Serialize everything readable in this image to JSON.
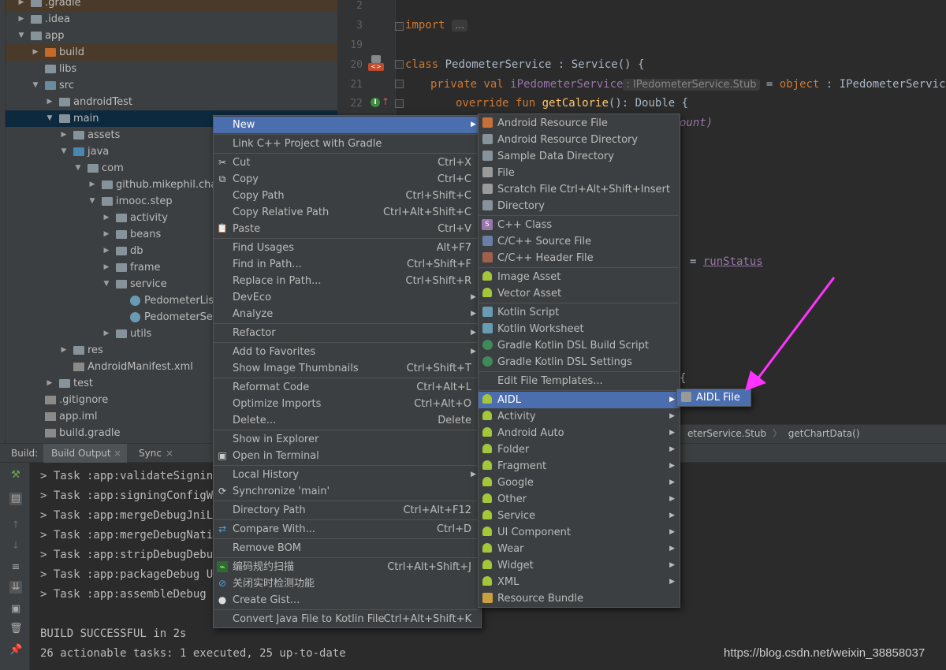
{
  "tree": {
    "items": [
      {
        "label": ".gradle",
        "depth": 1,
        "kind": "folder",
        "open": false
      },
      {
        "label": ".idea",
        "depth": 1,
        "kind": "folder",
        "open": false
      },
      {
        "label": "app",
        "depth": 1,
        "kind": "folder",
        "open": true
      },
      {
        "label": "build",
        "depth": 2,
        "kind": "build",
        "open": false
      },
      {
        "label": "libs",
        "depth": 2,
        "kind": "folder",
        "open": null
      },
      {
        "label": "src",
        "depth": 2,
        "kind": "src",
        "open": true
      },
      {
        "label": "androidTest",
        "depth": 3,
        "kind": "folder",
        "open": false
      },
      {
        "label": "main",
        "depth": 3,
        "kind": "folder",
        "open": true
      },
      {
        "label": "assets",
        "depth": 4,
        "kind": "folder",
        "open": false
      },
      {
        "label": "java",
        "depth": 4,
        "kind": "java",
        "open": true
      },
      {
        "label": "com",
        "depth": 5,
        "kind": "folder",
        "open": true
      },
      {
        "label": "github.mikephil.char",
        "depth": 6,
        "kind": "folder",
        "open": false
      },
      {
        "label": "imooc.step",
        "depth": 6,
        "kind": "folder",
        "open": true
      },
      {
        "label": "activity",
        "depth": 7,
        "kind": "folder",
        "open": false
      },
      {
        "label": "beans",
        "depth": 7,
        "kind": "folder",
        "open": false
      },
      {
        "label": "db",
        "depth": 7,
        "kind": "folder",
        "open": false
      },
      {
        "label": "frame",
        "depth": 7,
        "kind": "folder",
        "open": false
      },
      {
        "label": "service",
        "depth": 7,
        "kind": "folder",
        "open": true
      },
      {
        "label": "PedometerList",
        "depth": 8,
        "kind": "kt",
        "open": null
      },
      {
        "label": "PedometerSer",
        "depth": 8,
        "kind": "kt",
        "open": null
      },
      {
        "label": "utils",
        "depth": 7,
        "kind": "folder",
        "open": false
      },
      {
        "label": "res",
        "depth": 4,
        "kind": "folder",
        "open": false
      },
      {
        "label": "AndroidManifest.xml",
        "depth": 4,
        "kind": "file",
        "open": null
      },
      {
        "label": "test",
        "depth": 3,
        "kind": "folder",
        "open": false
      },
      {
        "label": ".gitignore",
        "depth": 2,
        "kind": "file",
        "open": null
      },
      {
        "label": "app.iml",
        "depth": 2,
        "kind": "file",
        "open": null
      },
      {
        "label": "build.gradle",
        "depth": 2,
        "kind": "file",
        "open": null
      }
    ]
  },
  "editor": {
    "line_numbers": [
      "2",
      "3",
      "19",
      "20",
      "21",
      "22"
    ],
    "line3_kw": "import",
    "line3_fold": "...",
    "line20_kw": "class",
    "line20_rest": " PedometerService : Service() {",
    "line21_kw": "private val",
    "line21_var": "iPedometerService",
    "line21_hint": ": IPedometerService.Stub",
    "line21_rest": " = ",
    "line21_kw2": "object",
    "line21_rest2": " : IPedometerServic",
    "line22_kw": "override fun",
    "line22_fn": "getCalorie",
    "line22_rest": "(): Double {",
    "frag_ount": "ount)",
    "frag_eq": "= ",
    "frag_run": "runStatus",
    "frag_brace": "{"
  },
  "breadcrumb": {
    "part1": "eterService.Stub",
    "sep": "〉",
    "part2": "getChartData()"
  },
  "build": {
    "label": "Build:",
    "tabs": [
      "Build Output",
      "Sync"
    ],
    "lines": [
      "> Task :app:validateSigningD",
      "> Task :app:signingConfigWr",
      "> Task :app:mergeDebugJniLi",
      "> Task :app:mergeDebugNativ",
      "> Task :app:stripDebugDebug",
      "> Task :app:packageDebug UP",
      "> Task :app:assembleDebug U"
    ],
    "success": "BUILD SUCCESSFUL in 2s",
    "summary": "26 actionable tasks: 1 executed, 25 up-to-date"
  },
  "context_menu": {
    "items": [
      {
        "label": "New",
        "shortcut": "",
        "submenu": true,
        "active": true,
        "icon": ""
      },
      {
        "sep": true
      },
      {
        "label": "Link C++ Project with Gradle",
        "shortcut": "",
        "submenu": false,
        "icon": ""
      },
      {
        "sep": true
      },
      {
        "label": "Cut",
        "shortcut": "Ctrl+X",
        "submenu": false,
        "icon": "scissors-icon"
      },
      {
        "label": "Copy",
        "shortcut": "Ctrl+C",
        "submenu": false,
        "icon": "copy-icon"
      },
      {
        "label": "Copy Path",
        "shortcut": "Ctrl+Shift+C",
        "submenu": false,
        "icon": ""
      },
      {
        "label": "Copy Relative Path",
        "shortcut": "Ctrl+Alt+Shift+C",
        "submenu": false,
        "icon": ""
      },
      {
        "label": "Paste",
        "shortcut": "Ctrl+V",
        "submenu": false,
        "icon": "paste-icon"
      },
      {
        "sep": true
      },
      {
        "label": "Find Usages",
        "shortcut": "Alt+F7",
        "submenu": false,
        "icon": ""
      },
      {
        "label": "Find in Path...",
        "shortcut": "Ctrl+Shift+F",
        "submenu": false,
        "icon": ""
      },
      {
        "label": "Replace in Path...",
        "shortcut": "Ctrl+Shift+R",
        "submenu": false,
        "icon": ""
      },
      {
        "label": "DevEco",
        "shortcut": "",
        "submenu": true,
        "icon": ""
      },
      {
        "label": "Analyze",
        "shortcut": "",
        "submenu": true,
        "icon": ""
      },
      {
        "sep": true
      },
      {
        "label": "Refactor",
        "shortcut": "",
        "submenu": true,
        "icon": ""
      },
      {
        "sep": true
      },
      {
        "label": "Add to Favorites",
        "shortcut": "",
        "submenu": true,
        "icon": ""
      },
      {
        "label": "Show Image Thumbnails",
        "shortcut": "Ctrl+Shift+T",
        "submenu": false,
        "icon": ""
      },
      {
        "sep": true
      },
      {
        "label": "Reformat Code",
        "shortcut": "Ctrl+Alt+L",
        "submenu": false,
        "icon": ""
      },
      {
        "label": "Optimize Imports",
        "shortcut": "Ctrl+Alt+O",
        "submenu": false,
        "icon": ""
      },
      {
        "label": "Delete...",
        "shortcut": "Delete",
        "submenu": false,
        "icon": ""
      },
      {
        "sep": true
      },
      {
        "label": "Show in Explorer",
        "shortcut": "",
        "submenu": false,
        "icon": ""
      },
      {
        "label": "Open in Terminal",
        "shortcut": "",
        "submenu": false,
        "icon": "terminal-icon"
      },
      {
        "sep": true
      },
      {
        "label": "Local History",
        "shortcut": "",
        "submenu": true,
        "icon": ""
      },
      {
        "label": "Synchronize 'main'",
        "shortcut": "",
        "submenu": false,
        "icon": "sync-icon"
      },
      {
        "sep": true
      },
      {
        "label": "Directory Path",
        "shortcut": "Ctrl+Alt+F12",
        "submenu": false,
        "icon": ""
      },
      {
        "sep": true
      },
      {
        "label": "Compare With...",
        "shortcut": "Ctrl+D",
        "submenu": false,
        "icon": "compare-icon"
      },
      {
        "sep": true
      },
      {
        "label": "Remove BOM",
        "shortcut": "",
        "submenu": false,
        "icon": ""
      },
      {
        "sep": true
      },
      {
        "label": "编码规约扫描",
        "shortcut": "Ctrl+Alt+Shift+J",
        "submenu": false,
        "icon": "scan-icon"
      },
      {
        "label": "关闭实时检测功能",
        "shortcut": "",
        "submenu": false,
        "icon": "disable-icon"
      },
      {
        "label": "Create Gist...",
        "shortcut": "",
        "submenu": false,
        "icon": "github-icon"
      },
      {
        "sep": true
      },
      {
        "label": "Convert Java File to Kotlin File",
        "shortcut": "Ctrl+Alt+Shift+K",
        "submenu": false,
        "icon": ""
      }
    ]
  },
  "new_menu": {
    "items": [
      {
        "label": "Android Resource File",
        "shortcut": "",
        "submenu": false,
        "icon": "android-resource-file-icon",
        "color": "#c8703a"
      },
      {
        "label": "Android Resource Directory",
        "shortcut": "",
        "submenu": false,
        "icon": "folder-icon",
        "color": "#87939a"
      },
      {
        "label": "Sample Data Directory",
        "shortcut": "",
        "submenu": false,
        "icon": "folder-icon",
        "color": "#87939a"
      },
      {
        "label": "File",
        "shortcut": "",
        "submenu": false,
        "icon": "file-icon",
        "color": "#9a9a9a"
      },
      {
        "label": "Scratch File",
        "shortcut": "Ctrl+Alt+Shift+Insert",
        "submenu": false,
        "icon": "scratch-file-icon",
        "color": "#9a9a9a"
      },
      {
        "label": "Directory",
        "shortcut": "",
        "submenu": false,
        "icon": "folder-icon",
        "color": "#87939a"
      },
      {
        "sep": true
      },
      {
        "label": "C++ Class",
        "shortcut": "",
        "submenu": false,
        "icon": "cpp-class-icon",
        "color": "#9876aa"
      },
      {
        "label": "C/C++ Source File",
        "shortcut": "",
        "submenu": false,
        "icon": "cpp-source-icon",
        "color": "#6a7fa8"
      },
      {
        "label": "C/C++ Header File",
        "shortcut": "",
        "submenu": false,
        "icon": "cpp-header-icon",
        "color": "#a0614c"
      },
      {
        "sep": true
      },
      {
        "label": "Image Asset",
        "shortcut": "",
        "submenu": false,
        "icon": "android-icon",
        "color": "#a4c639"
      },
      {
        "label": "Vector Asset",
        "shortcut": "",
        "submenu": false,
        "icon": "android-icon",
        "color": "#a4c639"
      },
      {
        "sep": true
      },
      {
        "label": "Kotlin Script",
        "shortcut": "",
        "submenu": false,
        "icon": "kotlin-icon",
        "color": "#6a9bb5"
      },
      {
        "label": "Kotlin Worksheet",
        "shortcut": "",
        "submenu": false,
        "icon": "kotlin-icon",
        "color": "#6a9bb5"
      },
      {
        "label": "Gradle Kotlin DSL Build Script",
        "shortcut": "",
        "submenu": false,
        "icon": "gradle-icon",
        "color": "#3d8b5a"
      },
      {
        "label": "Gradle Kotlin DSL Settings",
        "shortcut": "",
        "submenu": false,
        "icon": "gradle-icon",
        "color": "#3d8b5a"
      },
      {
        "sep": true
      },
      {
        "label": "Edit File Templates...",
        "shortcut": "",
        "submenu": false,
        "icon": "",
        "color": ""
      },
      {
        "sep": true
      },
      {
        "label": "AIDL",
        "shortcut": "",
        "submenu": true,
        "active": true,
        "icon": "android-icon",
        "color": "#a4c639"
      },
      {
        "label": "Activity",
        "shortcut": "",
        "submenu": true,
        "icon": "android-icon",
        "color": "#a4c639"
      },
      {
        "label": "Android Auto",
        "shortcut": "",
        "submenu": true,
        "icon": "android-icon",
        "color": "#a4c639"
      },
      {
        "label": "Folder",
        "shortcut": "",
        "submenu": true,
        "icon": "android-icon",
        "color": "#a4c639"
      },
      {
        "label": "Fragment",
        "shortcut": "",
        "submenu": true,
        "icon": "android-icon",
        "color": "#a4c639"
      },
      {
        "label": "Google",
        "shortcut": "",
        "submenu": true,
        "icon": "android-icon",
        "color": "#a4c639"
      },
      {
        "label": "Other",
        "shortcut": "",
        "submenu": true,
        "icon": "android-icon",
        "color": "#a4c639"
      },
      {
        "label": "Service",
        "shortcut": "",
        "submenu": true,
        "icon": "android-icon",
        "color": "#a4c639"
      },
      {
        "label": "UI Component",
        "shortcut": "",
        "submenu": true,
        "icon": "android-icon",
        "color": "#a4c639"
      },
      {
        "label": "Wear",
        "shortcut": "",
        "submenu": true,
        "icon": "android-icon",
        "color": "#a4c639"
      },
      {
        "label": "Widget",
        "shortcut": "",
        "submenu": true,
        "icon": "android-icon",
        "color": "#a4c639"
      },
      {
        "label": "XML",
        "shortcut": "",
        "submenu": true,
        "icon": "android-icon",
        "color": "#a4c639"
      },
      {
        "label": "Resource Bundle",
        "shortcut": "",
        "submenu": false,
        "icon": "resource-bundle-icon",
        "color": "#c8a040"
      }
    ]
  },
  "aidl_menu": {
    "items": [
      {
        "label": "AIDL File",
        "active": true,
        "icon": "aidl-file-icon"
      }
    ]
  },
  "annotation": {
    "arrow_color": "#ff33ff"
  },
  "watermark": "https://blog.csdn.net/weixin_38858037"
}
